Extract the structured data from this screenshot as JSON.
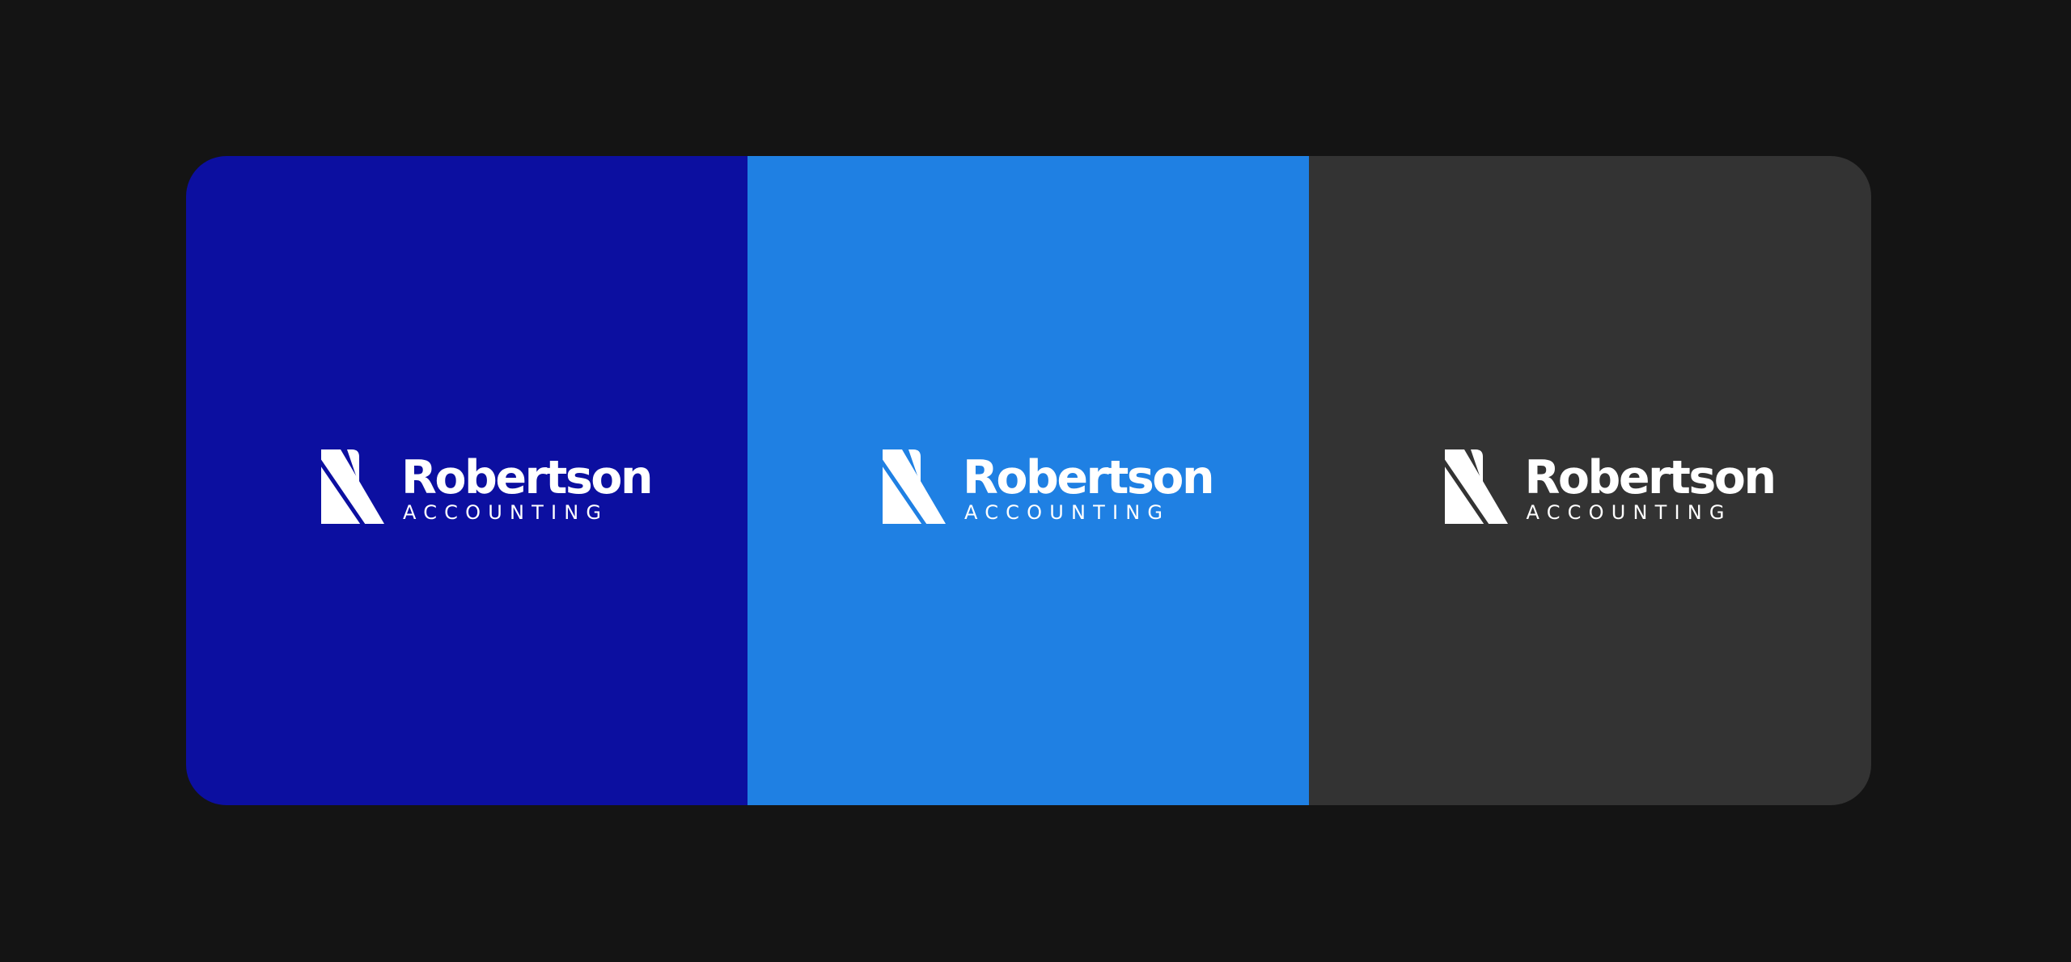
{
  "brand": {
    "name": "Robertson",
    "subtitle": "ACCOUNTING"
  },
  "colors": {
    "page_background": "#141414",
    "logo": "#ffffff"
  },
  "panels": [
    {
      "id": "navy",
      "background": "#0c0fa0"
    },
    {
      "id": "blue",
      "background": "#1f80e3"
    },
    {
      "id": "charcoal",
      "background": "#333333"
    }
  ],
  "icons": {
    "logo_mark": "r-slash-mark-icon"
  }
}
